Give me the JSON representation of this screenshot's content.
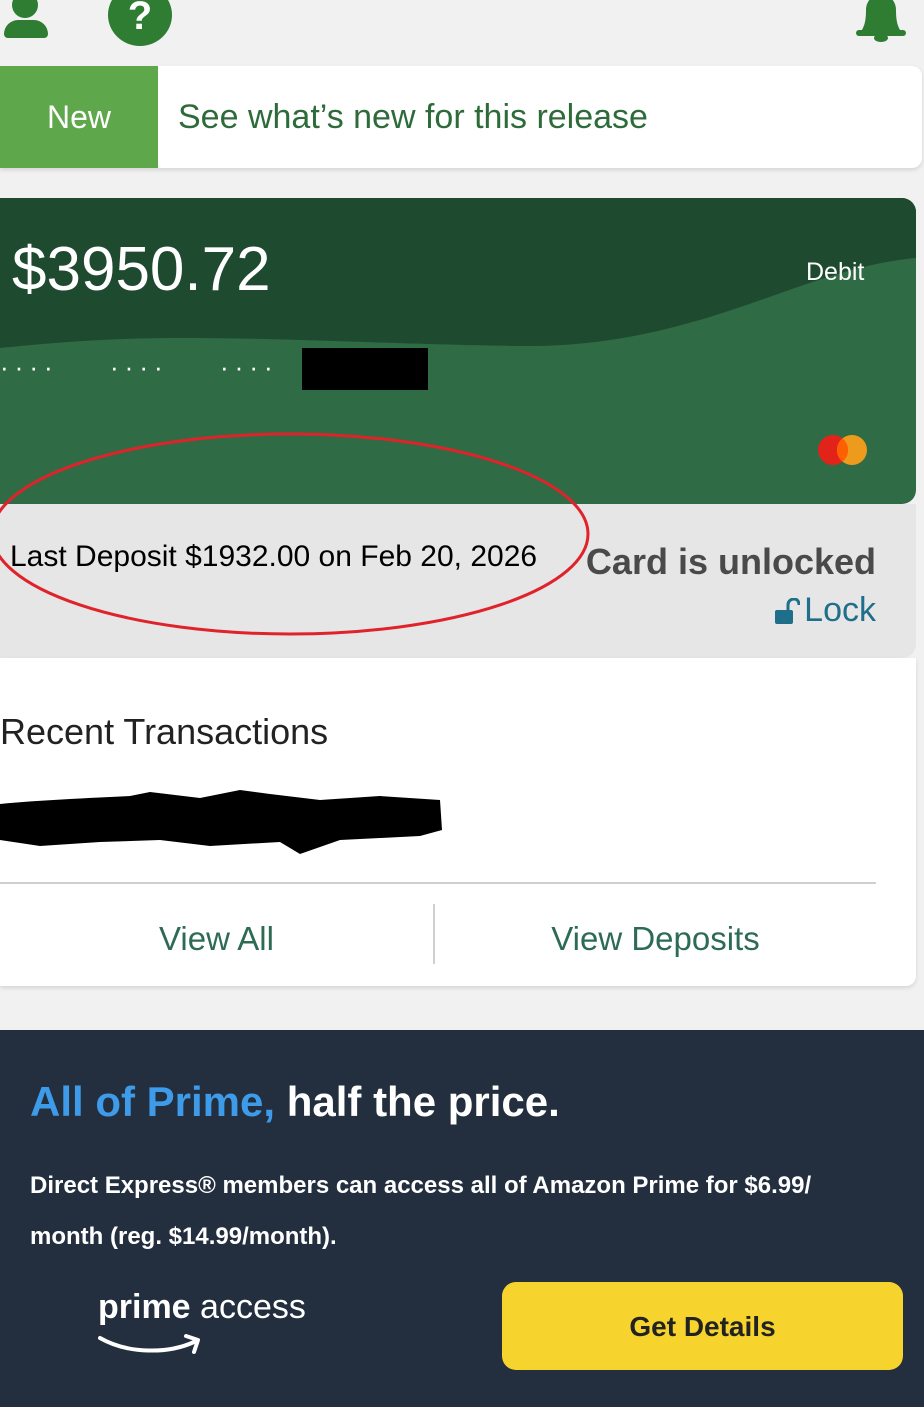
{
  "header": {
    "profile_icon": "user-icon",
    "help_icon": "help-icon",
    "help_glyph": "?",
    "notifications_icon": "bell-icon"
  },
  "banner": {
    "badge": "New",
    "text": "See what’s new for this release"
  },
  "card": {
    "balance": "$3950.72",
    "type": "Debit",
    "masked_groups": [
      "····",
      "····",
      "····"
    ],
    "network_icon": "mastercard-icon",
    "colors": {
      "dark": "#1e4a30",
      "main": "#2f6b45"
    }
  },
  "deposit": {
    "text": "Last Deposit $1932.00 on Feb 20, 2026"
  },
  "card_status": {
    "status": "Card is unlocked",
    "lock_label": "Lock",
    "lock_icon": "unlocked-padlock-icon"
  },
  "transactions": {
    "title": "Recent Transactions",
    "view_all": "View All",
    "view_deposits": "View Deposits"
  },
  "promo": {
    "headline_highlight": "All of Prime,",
    "headline_rest": "half the price.",
    "body": "Direct Express® members can access all of Amazon Prime for $6.99/ month (reg. $14.99/month).",
    "logo_bold": "prime",
    "logo_rest": "access",
    "cta": "Get Details",
    "colors": {
      "background": "#232f3e",
      "cta": "#f7d42d",
      "highlight": "#3d9be9"
    }
  }
}
